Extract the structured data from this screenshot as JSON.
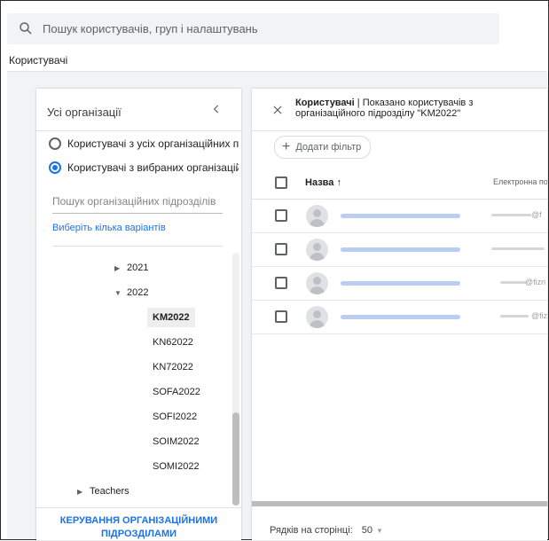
{
  "search": {
    "placeholder": "Пошук користувачів, груп і налаштувань"
  },
  "breadcrumb": "Користувачі",
  "org_panel": {
    "title": "Усі організації",
    "radio_all": "Користувачі з усіх організаційних підрозділів",
    "radio_selected": "Користувачі з вибраних організаційних підрозділів",
    "search_placeholder": "Пошук організаційних підрозділів",
    "multi_select_link": "Виберіть кілька варіантів",
    "tree": {
      "item_2021": "2021",
      "item_2022": "2022",
      "children_2022": [
        "KM2022",
        "KN62022",
        "KN72022",
        "SOFA2022",
        "SOFI2022",
        "SOIM2022",
        "SOMI2022"
      ],
      "item_teachers": "Teachers"
    },
    "manage_link_line1": "КЕРУВАННЯ ОРГАНІЗАЦІЙНИМИ",
    "manage_link_line2": "ПІДРОЗДІЛАМИ"
  },
  "users_panel": {
    "title_bold": "Користувачі",
    "title_rest": " | Показано користувачів з організаційного підрозділу \"KM2022\"",
    "add_filter": "Додати фільтр",
    "col_name": "Назва ↑",
    "col_email": "Електронна по",
    "rows": [
      {
        "email_suffix": "@f"
      },
      {
        "email_suffix": ""
      },
      {
        "email_suffix": "@fizn"
      },
      {
        "email_suffix": "@fiz"
      }
    ],
    "rows_per_page_label": "Рядків на сторінці:",
    "rows_per_page_value": "50"
  }
}
